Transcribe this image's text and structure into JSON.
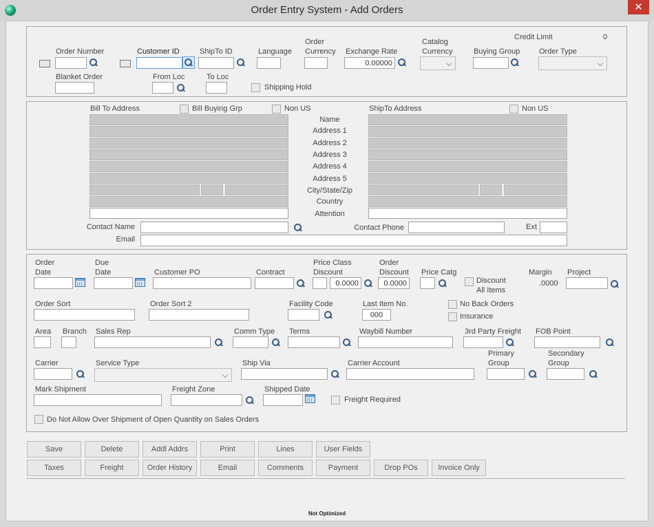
{
  "window": {
    "title": "Order Entry System - Add Orders",
    "close": "✕"
  },
  "header": {
    "credit_limit_label": "Credit Limit",
    "credit_limit_value": "0",
    "order_number": "Order Number",
    "customer_id": "Customer ID",
    "shipto_id": "ShipTo ID",
    "language": "Language",
    "order_currency_1": "Order",
    "order_currency_2": "Currency",
    "exchange_rate": "Exchange Rate",
    "exchange_rate_value": "0.00000",
    "catalog_currency_1": "Catalog",
    "catalog_currency_2": "Currency",
    "buying_group": "Buying Group",
    "order_type": "Order Type",
    "blanket_order": "Blanket Order",
    "from_loc": "From Loc",
    "to_loc": "To Loc",
    "shipping_hold": "Shipping Hold"
  },
  "address": {
    "bill_to": "Bill To Address",
    "bill_buying_grp": "Bill Buying Grp",
    "non_us": "Non US",
    "shipto": "ShipTo Address",
    "non_us_2": "Non US",
    "rows": [
      "Name",
      "Address 1",
      "Address 2",
      "Address 3",
      "Address 4",
      "Address 5",
      "City/State/Zip",
      "Country",
      "Attention"
    ],
    "contact_name": "Contact Name",
    "contact_phone": "Contact Phone",
    "ext": "Ext",
    "email": "Email"
  },
  "order": {
    "order_date_1": "Order",
    "order_date_2": "Date",
    "due_date_1": "Due",
    "due_date_2": "Date",
    "customer_po": "Customer PO",
    "contract": "Contract",
    "price_class_1": "Price Class",
    "price_class_2": "Discount",
    "price_class_value": "0.0000",
    "order_discount_1": "Order",
    "order_discount_2": "Discount",
    "order_discount_value": "0.0000",
    "price_catg": "Price Catg",
    "discount_all_1": "Discount",
    "discount_all_2": "All Items",
    "margin": "Margin",
    "margin_value": ".0000",
    "project": "Project",
    "order_sort": "Order Sort",
    "order_sort_2": "Order Sort 2",
    "facility_code": "Facility Code",
    "last_item_no": "Last Item No.",
    "last_item_value": "000",
    "no_back_orders": "No Back Orders",
    "insurance": "Insurance",
    "area": "Area",
    "branch": "Branch",
    "sales_rep": "Sales Rep",
    "comm_type": "Comm Type",
    "terms": "Terms",
    "waybill": "Waybill Number",
    "third_party": "3rd Party Freight",
    "fob_point": "FOB Point",
    "carrier": "Carrier",
    "service_type": "Service Type",
    "ship_via": "Ship Via",
    "carrier_account": "Carrier Account",
    "primary_group_1": "Primary",
    "primary_group_2": "Group",
    "secondary_group_1": "Secondary",
    "secondary_group_2": "Group",
    "mark_shipment": "Mark Shipment",
    "freight_zone": "Freight Zone",
    "shipped_date": "Shipped Date",
    "freight_required": "Freight Required",
    "no_over_shipment": "Do Not Allow Over Shipment of Open Quantity on Sales Orders"
  },
  "buttons": {
    "row1": [
      "Save",
      "Delete",
      "Addl Addrs",
      "Print",
      "Lines",
      "User Fields"
    ],
    "row2": [
      "Taxes",
      "Freight",
      "Order History",
      "Email",
      "Comments",
      "Payment",
      "Drop POs",
      "Invoice Only"
    ]
  },
  "status": "Not Optimized"
}
